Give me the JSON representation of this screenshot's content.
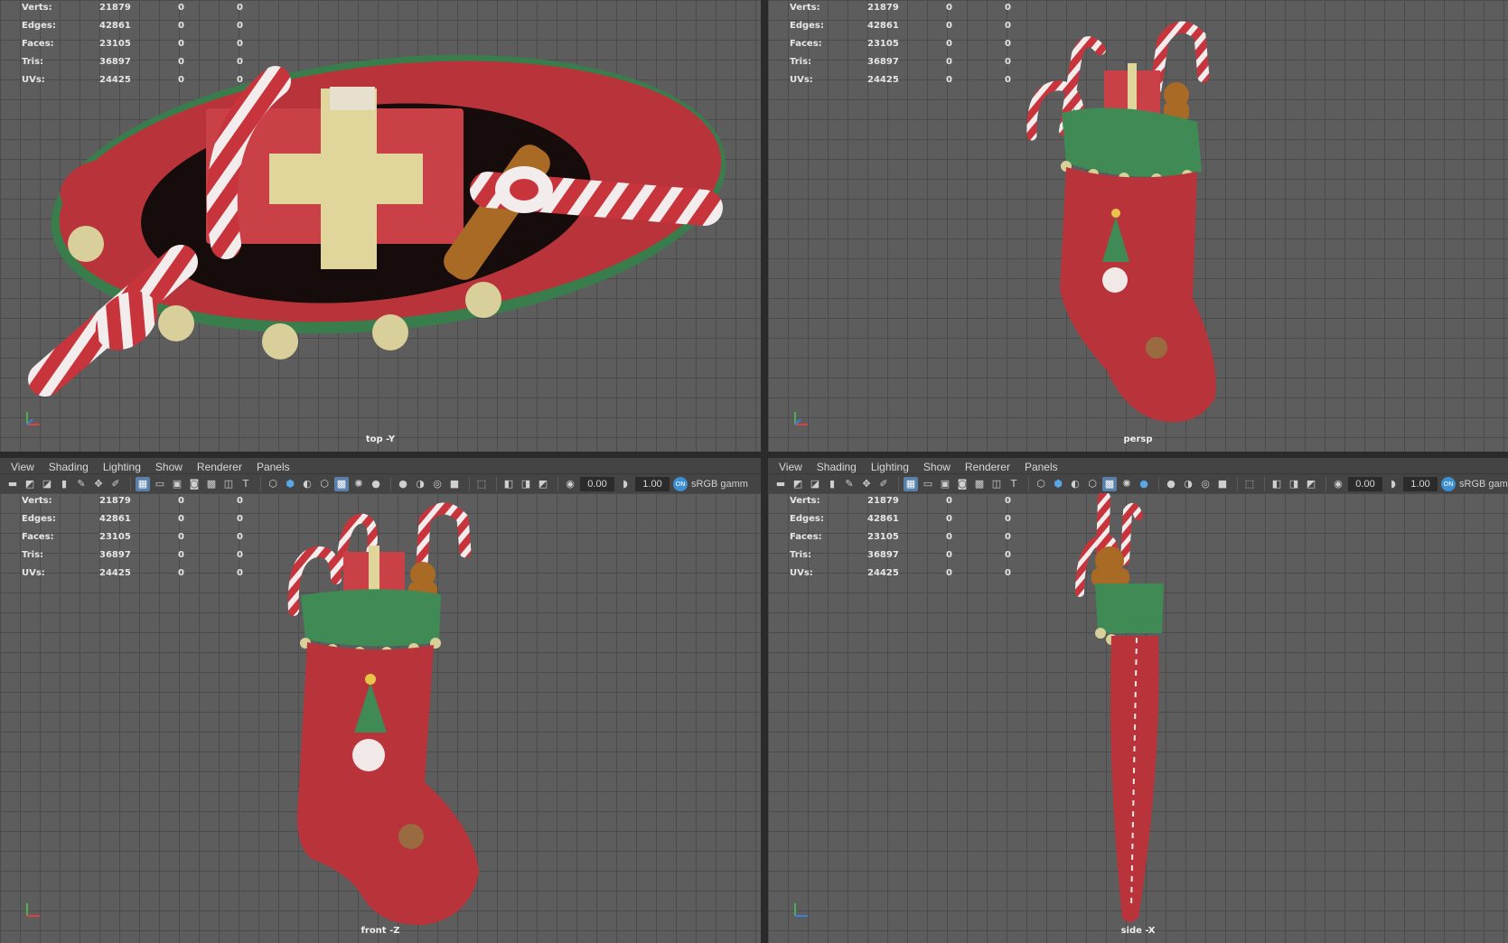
{
  "hud_stats": [
    {
      "label": "Verts:",
      "v1": "21879",
      "v2": "0",
      "v3": "0"
    },
    {
      "label": "Edges:",
      "v1": "42861",
      "v2": "0",
      "v3": "0"
    },
    {
      "label": "Faces:",
      "v1": "23105",
      "v2": "0",
      "v3": "0"
    },
    {
      "label": "Tris:",
      "v1": "36897",
      "v2": "0",
      "v3": "0"
    },
    {
      "label": "UVs:",
      "v1": "24425",
      "v2": "0",
      "v3": "0"
    }
  ],
  "viewports": {
    "top": {
      "camera": "top -Y"
    },
    "persp": {
      "camera": "persp"
    },
    "front": {
      "camera": "front -Z"
    },
    "side": {
      "camera": "side -X"
    }
  },
  "panel_menu": [
    "View",
    "Shading",
    "Lighting",
    "Show",
    "Renderer",
    "Panels"
  ],
  "toolbar": {
    "exposure_value": "0.00",
    "gamma_value": "1.00",
    "color_space": "sRGB gamm",
    "on_badge": "ON"
  },
  "colors": {
    "viewport_bg": "#5d5d5d",
    "grid": "#4b4b4b",
    "panel_bg": "#444444",
    "stocking_red": "#b8343a",
    "cuff_green": "#3f8a55",
    "gold": "#d8cf9a"
  },
  "icons": [
    "camera-icon",
    "bookmark-icon",
    "grid-icon",
    "wireframe-icon",
    "smooth-shade-icon",
    "texture-icon",
    "light-icon",
    "shadow-icon",
    "isolate-icon",
    "xray-icon",
    "exposure-icon",
    "gamma-icon",
    "color-management-icon"
  ]
}
